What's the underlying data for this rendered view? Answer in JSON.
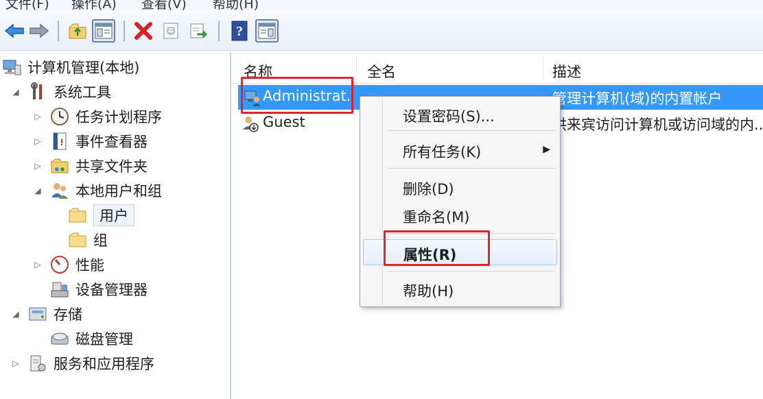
{
  "menubar": {
    "items": [
      "文件(F)",
      "操作(A)",
      "查看(V)",
      "帮助(H)"
    ]
  },
  "toolbar": {
    "buttons": [
      "back-icon",
      "forward-icon",
      "up-folder-icon",
      "show-tree-icon",
      "delete-icon",
      "properties-icon",
      "export-icon",
      "help-icon",
      "action-pane-icon"
    ]
  },
  "tree": {
    "root": "计算机管理(本地)",
    "system_tools": "系统工具",
    "task_scheduler": "任务计划程序",
    "event_viewer": "事件查看器",
    "shared_folders": "共享文件夹",
    "local_users_groups": "本地用户和组",
    "users": "用户",
    "groups": "组",
    "performance": "性能",
    "device_manager": "设备管理器",
    "storage": "存储",
    "disk_management": "磁盘管理",
    "services_apps": "服务和应用程序"
  },
  "list": {
    "columns": [
      "名称",
      "全名",
      "描述"
    ],
    "rows": [
      {
        "name": "Administrat...",
        "fullname": "",
        "description": "管理计算机(域)的内置帐户"
      },
      {
        "name": "Guest",
        "fullname": "",
        "description": "供来宾访问计算机或访问域的内..."
      }
    ]
  },
  "context_menu": {
    "set_password": "设置密码(S)...",
    "all_tasks": "所有任务(K)",
    "submenu_arrow": "▶",
    "delete": "删除(D)",
    "rename": "重命名(M)",
    "properties": "属性(R)",
    "help": "帮助(H)"
  },
  "colors": {
    "highlight": "#3399ff",
    "annotation_red": "#e0242b"
  }
}
